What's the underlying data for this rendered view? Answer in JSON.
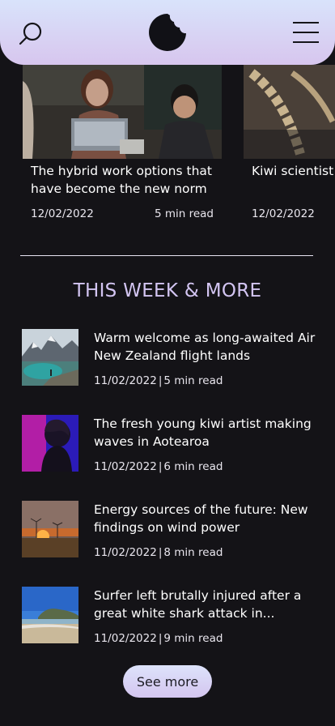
{
  "header": {
    "search_icon": "search-icon",
    "logo_icon": "bitten-moon-logo",
    "menu_icon": "hamburger-menu-icon",
    "colors": {
      "gradient_top": "#d9e3fb",
      "gradient_bottom": "#d7c6ee"
    }
  },
  "carousel": [
    {
      "title": "The hybrid work options that have become the new norm",
      "date": "12/02/2022",
      "read_time": "5 min read"
    },
    {
      "title": "Kiwi scientist year old preh",
      "date": "12/02/2022",
      "read_time": ""
    }
  ],
  "section": {
    "title": "THIS WEEK & MORE"
  },
  "articles": [
    {
      "title": "Warm welcome as long-awaited Air New Zealand flight lands",
      "date": "11/02/2022",
      "read_time": "5 min read"
    },
    {
      "title": "The fresh young kiwi artist making waves in Aotearoa",
      "date": "11/02/2022",
      "read_time": "6 min read"
    },
    {
      "title": "Energy sources of the future: New findings on wind power",
      "date": "11/02/2022",
      "read_time": "8 min read"
    },
    {
      "title": "Surfer left brutally injured after a great white shark attack in...",
      "date": "11/02/2022",
      "read_time": "9 min read"
    }
  ],
  "see_more_label": "See more",
  "accent": "#d3c5f2"
}
